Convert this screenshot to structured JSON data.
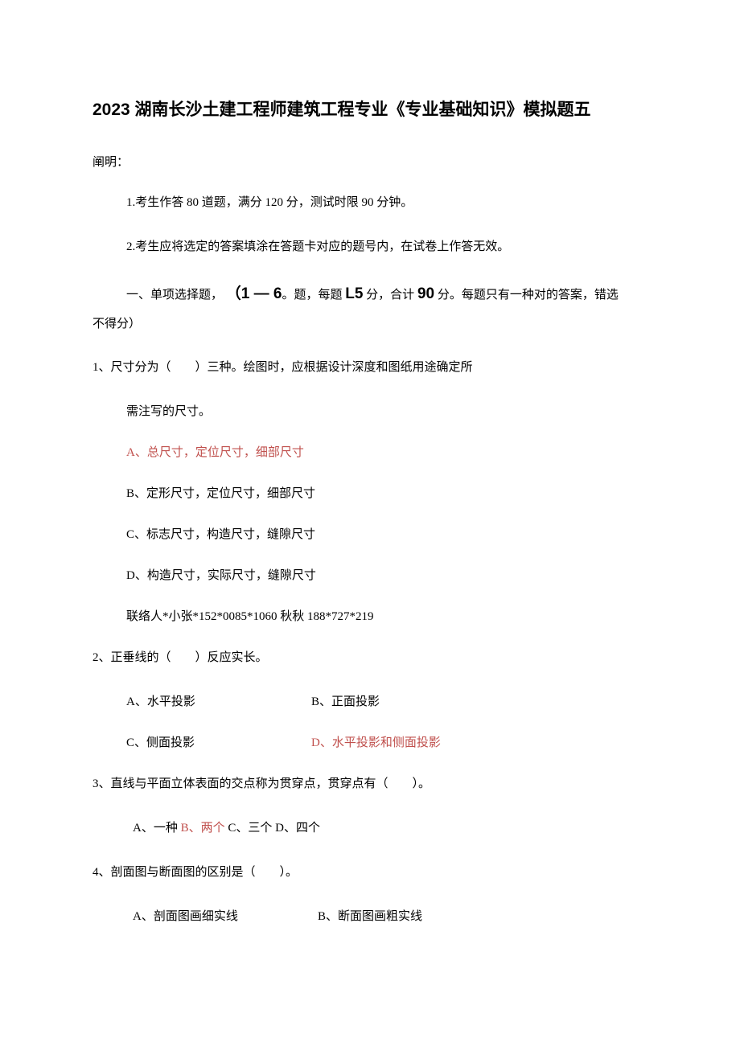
{
  "title": "2023 湖南长沙土建工程师建筑工程专业《专业基础知识》模拟题五",
  "intro_label": "阐明：",
  "instruction1": "1.考生作答 80 道题，满分 120 分，测试时限 90 分钟。",
  "instruction2": "2.考生应将选定的答案填涂在答题卡对应的题号内，在试卷上作答无效。",
  "section1_prefix": "一、单项选择题， ",
  "section1_bold": "（1 — 6",
  "section1_mid": "。题，每题 ",
  "section1_bold2": "L5",
  "section1_mid2": " 分，合计 ",
  "section1_bold3": "90",
  "section1_suffix": " 分。每题只有一种对的答案，错选",
  "no_score": "不得分）",
  "q1": {
    "text": "1、尺寸分为（　　）三种。绘图时，应根据设计深度和图纸用途确定所",
    "sub": "需注写的尺寸。",
    "a": "A、总尺寸，定位尺寸，细部尺寸",
    "b": "B、定形尺寸，定位尺寸，细部尺寸",
    "c": "C、标志尺寸，构造尺寸，缝隙尺寸",
    "d": "D、构造尺寸，实际尺寸，缝隙尺寸",
    "contact": "联络人*小张*152*0085*1060 秋秋 188*727*219"
  },
  "q2": {
    "text": "2、正垂线的（　　）反应实长。",
    "a": "A、水平投影",
    "b": "B、正面投影",
    "c": "C、侧面投影",
    "d": "D、水平投影和侧面投影"
  },
  "q3": {
    "text": "3、直线与平面立体表面的交点称为贯穿点，贯穿点有（　　）。",
    "a": "A、一种 ",
    "b": "B、两个 ",
    "c": "C、三个 ",
    "d": "D、四个"
  },
  "q4": {
    "text": "4、剖面图与断面图的区别是（　　）。",
    "a": "A、剖面图画细实线",
    "b": "B、断面图画粗实线"
  }
}
